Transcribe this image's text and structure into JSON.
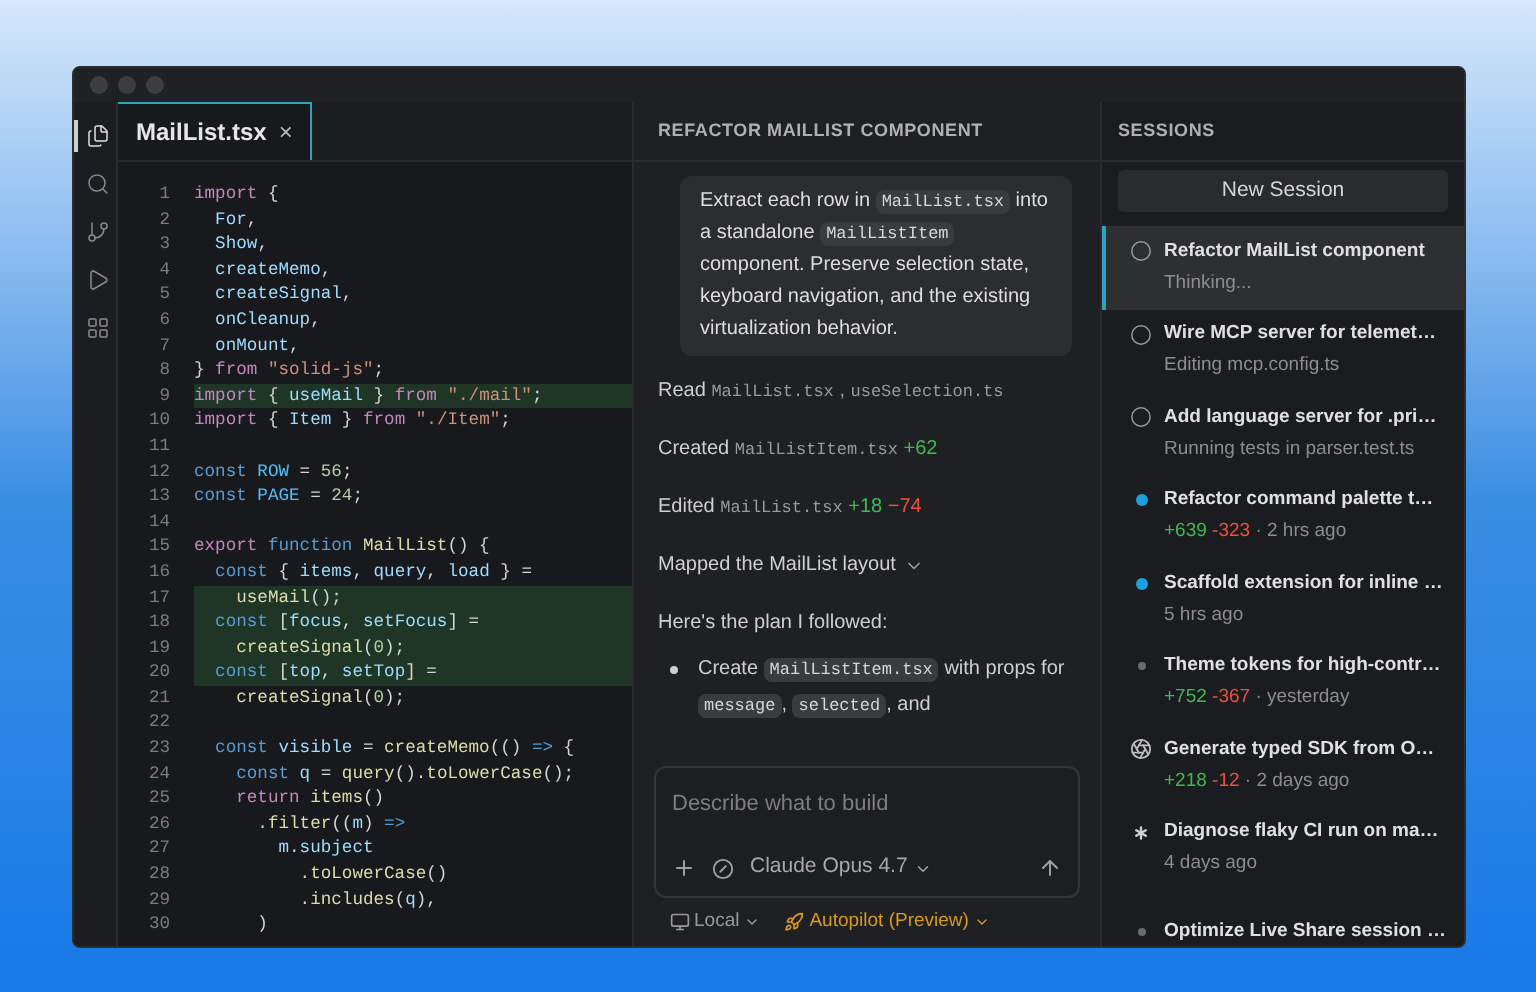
{
  "activity_bar": [
    {
      "kind": "files",
      "selected": true
    },
    {
      "kind": "search",
      "selected": false
    },
    {
      "kind": "source-control",
      "selected": false
    },
    {
      "kind": "run",
      "selected": false
    },
    {
      "kind": "extensions",
      "selected": false
    }
  ],
  "editor": {
    "tab": {
      "label": "MailList.tsx",
      "close": "×"
    },
    "lines": [
      {
        "n": "1",
        "added": false,
        "tokens": [
          {
            "kind": "kw",
            "text": "import"
          },
          {
            "kind": "p",
            "text": " {"
          }
        ]
      },
      {
        "n": "2",
        "added": false,
        "tokens": [
          {
            "kind": "var",
            "text": "  For"
          },
          {
            "kind": "p",
            "text": ","
          }
        ]
      },
      {
        "n": "3",
        "added": false,
        "tokens": [
          {
            "kind": "var",
            "text": "  Show"
          },
          {
            "kind": "p",
            "text": ","
          }
        ]
      },
      {
        "n": "4",
        "added": false,
        "tokens": [
          {
            "kind": "var",
            "text": "  createMemo"
          },
          {
            "kind": "p",
            "text": ","
          }
        ]
      },
      {
        "n": "5",
        "added": false,
        "tokens": [
          {
            "kind": "var",
            "text": "  createSignal"
          },
          {
            "kind": "p",
            "text": ","
          }
        ]
      },
      {
        "n": "6",
        "added": false,
        "tokens": [
          {
            "kind": "var",
            "text": "  onCleanup"
          },
          {
            "kind": "p",
            "text": ","
          }
        ]
      },
      {
        "n": "7",
        "added": false,
        "tokens": [
          {
            "kind": "var",
            "text": "  onMount"
          },
          {
            "kind": "p",
            "text": ","
          }
        ]
      },
      {
        "n": "8",
        "added": false,
        "tokens": [
          {
            "kind": "p",
            "text": "}"
          },
          {
            "kind": "kw",
            "text": " from"
          },
          {
            "kind": "str",
            "text": " \"solid-js\""
          },
          {
            "kind": "p",
            "text": ";"
          }
        ]
      },
      {
        "n": "9",
        "added": true,
        "tokens": [
          {
            "kind": "kw",
            "text": "import"
          },
          {
            "kind": "p",
            "text": " {"
          },
          {
            "kind": "var",
            "text": " useMail"
          },
          {
            "kind": "p",
            "text": " }"
          },
          {
            "kind": "kw",
            "text": " from"
          },
          {
            "kind": "str",
            "text": " \"./mail\""
          },
          {
            "kind": "p",
            "text": ";"
          }
        ]
      },
      {
        "n": "10",
        "added": false,
        "tokens": [
          {
            "kind": "kw",
            "text": "import"
          },
          {
            "kind": "p",
            "text": " {"
          },
          {
            "kind": "var",
            "text": " Item"
          },
          {
            "kind": "p",
            "text": " }"
          },
          {
            "kind": "kw",
            "text": " from"
          },
          {
            "kind": "str",
            "text": " \"./Item\""
          },
          {
            "kind": "p",
            "text": ";"
          }
        ]
      },
      {
        "n": "11",
        "added": false
      },
      {
        "n": "12",
        "added": false,
        "tokens": [
          {
            "kind": "k2",
            "text": "const"
          },
          {
            "kind": "const",
            "text": " ROW"
          },
          {
            "kind": "p",
            "text": " ="
          },
          {
            "kind": "num",
            "text": " 56"
          },
          {
            "kind": "p",
            "text": ";"
          }
        ]
      },
      {
        "n": "13",
        "added": false,
        "tokens": [
          {
            "kind": "k2",
            "text": "const"
          },
          {
            "kind": "const",
            "text": " PAGE"
          },
          {
            "kind": "p",
            "text": " ="
          },
          {
            "kind": "num",
            "text": " 24"
          },
          {
            "kind": "p",
            "text": ";"
          }
        ]
      },
      {
        "n": "14",
        "added": false
      },
      {
        "n": "15",
        "added": false,
        "tokens": [
          {
            "kind": "kw",
            "text": "export"
          },
          {
            "kind": "k2",
            "text": " function"
          },
          {
            "kind": "fn",
            "text": " MailList"
          },
          {
            "kind": "p",
            "text": "() {"
          }
        ]
      },
      {
        "n": "16",
        "added": false,
        "tokens": [
          {
            "kind": "k2",
            "text": "  const"
          },
          {
            "kind": "p",
            "text": " {"
          },
          {
            "kind": "var",
            "text": " items"
          },
          {
            "kind": "p",
            "text": ","
          },
          {
            "kind": "var",
            "text": " query"
          },
          {
            "kind": "p",
            "text": ","
          },
          {
            "kind": "var",
            "text": " load"
          },
          {
            "kind": "p",
            "text": " } ="
          }
        ]
      },
      {
        "n": "17",
        "added": true,
        "tokens": [
          {
            "kind": "fn",
            "text": "    useMail"
          },
          {
            "kind": "p",
            "text": "();"
          }
        ]
      },
      {
        "n": "18",
        "added": true,
        "tokens": [
          {
            "kind": "k2",
            "text": "  const"
          },
          {
            "kind": "p",
            "text": " ["
          },
          {
            "kind": "var",
            "text": "focus"
          },
          {
            "kind": "p",
            "text": ","
          },
          {
            "kind": "var",
            "text": " setFocus"
          },
          {
            "kind": "p",
            "text": "] ="
          }
        ]
      },
      {
        "n": "19",
        "added": true,
        "tokens": [
          {
            "kind": "fn",
            "text": "    createSignal"
          },
          {
            "kind": "p",
            "text": "("
          },
          {
            "kind": "num",
            "text": "0"
          },
          {
            "kind": "p",
            "text": ");"
          }
        ]
      },
      {
        "n": "20",
        "added": true,
        "tokens": [
          {
            "kind": "k2",
            "text": "  const"
          },
          {
            "kind": "p",
            "text": " ["
          },
          {
            "kind": "var",
            "text": "top"
          },
          {
            "kind": "p",
            "text": ","
          },
          {
            "kind": "var",
            "text": " setTop"
          },
          {
            "kind": "p",
            "text": "] ="
          }
        ]
      },
      {
        "n": "21",
        "added": false,
        "tokens": [
          {
            "kind": "fn",
            "text": "    createSignal"
          },
          {
            "kind": "p",
            "text": "("
          },
          {
            "kind": "num",
            "text": "0"
          },
          {
            "kind": "p",
            "text": ");"
          }
        ]
      },
      {
        "n": "22",
        "added": false
      },
      {
        "n": "23",
        "added": false,
        "tokens": [
          {
            "kind": "k2",
            "text": "  const"
          },
          {
            "kind": "var",
            "text": " visible"
          },
          {
            "kind": "p",
            "text": " ="
          },
          {
            "kind": "fn",
            "text": " createMemo"
          },
          {
            "kind": "p",
            "text": "(()"
          },
          {
            "kind": "k2",
            "text": " =>"
          },
          {
            "kind": "p",
            "text": " {"
          }
        ]
      },
      {
        "n": "24",
        "added": false,
        "tokens": [
          {
            "kind": "k2",
            "text": "    const"
          },
          {
            "kind": "var",
            "text": " q"
          },
          {
            "kind": "p",
            "text": " ="
          },
          {
            "kind": "fn",
            "text": " query"
          },
          {
            "kind": "p",
            "text": "()."
          },
          {
            "kind": "fn",
            "text": "toLowerCase"
          },
          {
            "kind": "p",
            "text": "();"
          }
        ]
      },
      {
        "n": "25",
        "added": false,
        "tokens": [
          {
            "kind": "kw",
            "text": "    return"
          },
          {
            "kind": "fn",
            "text": " items"
          },
          {
            "kind": "p",
            "text": "()"
          }
        ]
      },
      {
        "n": "26",
        "added": false,
        "tokens": [
          {
            "kind": "p",
            "text": "      ."
          },
          {
            "kind": "fn",
            "text": "filter"
          },
          {
            "kind": "p",
            "text": "(("
          },
          {
            "kind": "var",
            "text": "m"
          },
          {
            "kind": "p",
            "text": ")"
          },
          {
            "kind": "k2",
            "text": " =>"
          }
        ]
      },
      {
        "n": "27",
        "added": false,
        "tokens": [
          {
            "kind": "var",
            "text": "        m"
          },
          {
            "kind": "p",
            "text": "."
          },
          {
            "kind": "var",
            "text": "subject"
          }
        ]
      },
      {
        "n": "28",
        "added": false,
        "tokens": [
          {
            "kind": "p",
            "text": "          ."
          },
          {
            "kind": "fn",
            "text": "toLowerCase"
          },
          {
            "kind": "p",
            "text": "()"
          }
        ]
      },
      {
        "n": "29",
        "added": false,
        "tokens": [
          {
            "kind": "p",
            "text": "          ."
          },
          {
            "kind": "fn",
            "text": "includes"
          },
          {
            "kind": "p",
            "text": "("
          },
          {
            "kind": "var",
            "text": "q"
          },
          {
            "kind": "p",
            "text": "),"
          }
        ]
      },
      {
        "n": "30",
        "added": false,
        "tokens": [
          {
            "kind": "p",
            "text": "      )"
          }
        ]
      }
    ]
  },
  "chat": {
    "title": "REFACTOR MAILLIST COMPONENT",
    "prompt": [
      {
        "kind": "text",
        "text": "Extract each row in "
      },
      {
        "kind": "code",
        "text": "MailList.tsx"
      },
      {
        "kind": "text",
        "text": " into a standalone "
      },
      {
        "kind": "code",
        "text": "MailListItem"
      },
      {
        "kind": "text",
        "text": " component. Preserve selection state, keyboard navigation, and the existing virtualization behavior."
      }
    ],
    "steps": [
      {
        "kind": "files",
        "verb": "Read",
        "files": [
          "MailList.tsx",
          "useSelection.ts"
        ],
        "separator": ","
      },
      {
        "kind": "diff",
        "verb": "Created",
        "file": "MailListItem.tsx",
        "added": "+62"
      },
      {
        "kind": "diff",
        "verb": "Edited",
        "file": "MailList.tsx",
        "added": "+18",
        "removed": "−74"
      },
      {
        "kind": "collapsed",
        "text": "Mapped the MailList layout",
        "expanded": false
      }
    ],
    "intro": "Here's the plan I followed:",
    "bullets": [
      [
        {
          "kind": "text",
          "text": "Create "
        },
        {
          "kind": "code",
          "text": "MailListItem.tsx"
        },
        {
          "kind": "text",
          "text": " with props for "
        },
        {
          "kind": "code",
          "text": "message"
        },
        {
          "kind": "text",
          "text": ", "
        },
        {
          "kind": "code",
          "text": "selected"
        },
        {
          "kind": "text",
          "text": ", and"
        }
      ]
    ],
    "input": {
      "placeholder": "Describe what to build",
      "model": "Claude Opus 4.7"
    },
    "footer": {
      "location": "Local",
      "mode": "Autopilot (Preview)"
    }
  },
  "sessions": {
    "title": "SESSIONS",
    "new_button": "New Session",
    "items": [
      {
        "kind": "running",
        "title": "Refactor MailList component",
        "detail": "Thinking...",
        "selected": true
      },
      {
        "kind": "running",
        "title": "Wire MCP server for telemet…",
        "detail": "Editing mcp.config.ts",
        "selected": false
      },
      {
        "kind": "running",
        "title": "Add language server for .pri…",
        "detail": "Running tests in parser.test.ts",
        "selected": false
      },
      {
        "kind": "unread",
        "title": "Refactor command palette t…",
        "added": "+639",
        "removed": "-323",
        "time": "· 2 hrs ago",
        "selected": false
      },
      {
        "kind": "unread",
        "title": "Scaffold extension for inline …",
        "detail": "5 hrs ago",
        "selected": false
      },
      {
        "kind": "idle",
        "title": "Theme tokens for high-contr…",
        "added": "+752",
        "removed": "-367",
        "time": "· yesterday",
        "selected": false
      },
      {
        "kind": "aperture",
        "title": "Generate typed SDK from O…",
        "added": "+218",
        "removed": "-12",
        "time": "· 2 days ago",
        "selected": false
      },
      {
        "kind": "asterisk",
        "title": "Diagnose flaky CI run on ma…",
        "detail": "4 days ago",
        "selected": false
      },
      {
        "kind": "idle",
        "title": "Optimize Live Share session …",
        "selected": false
      }
    ]
  }
}
